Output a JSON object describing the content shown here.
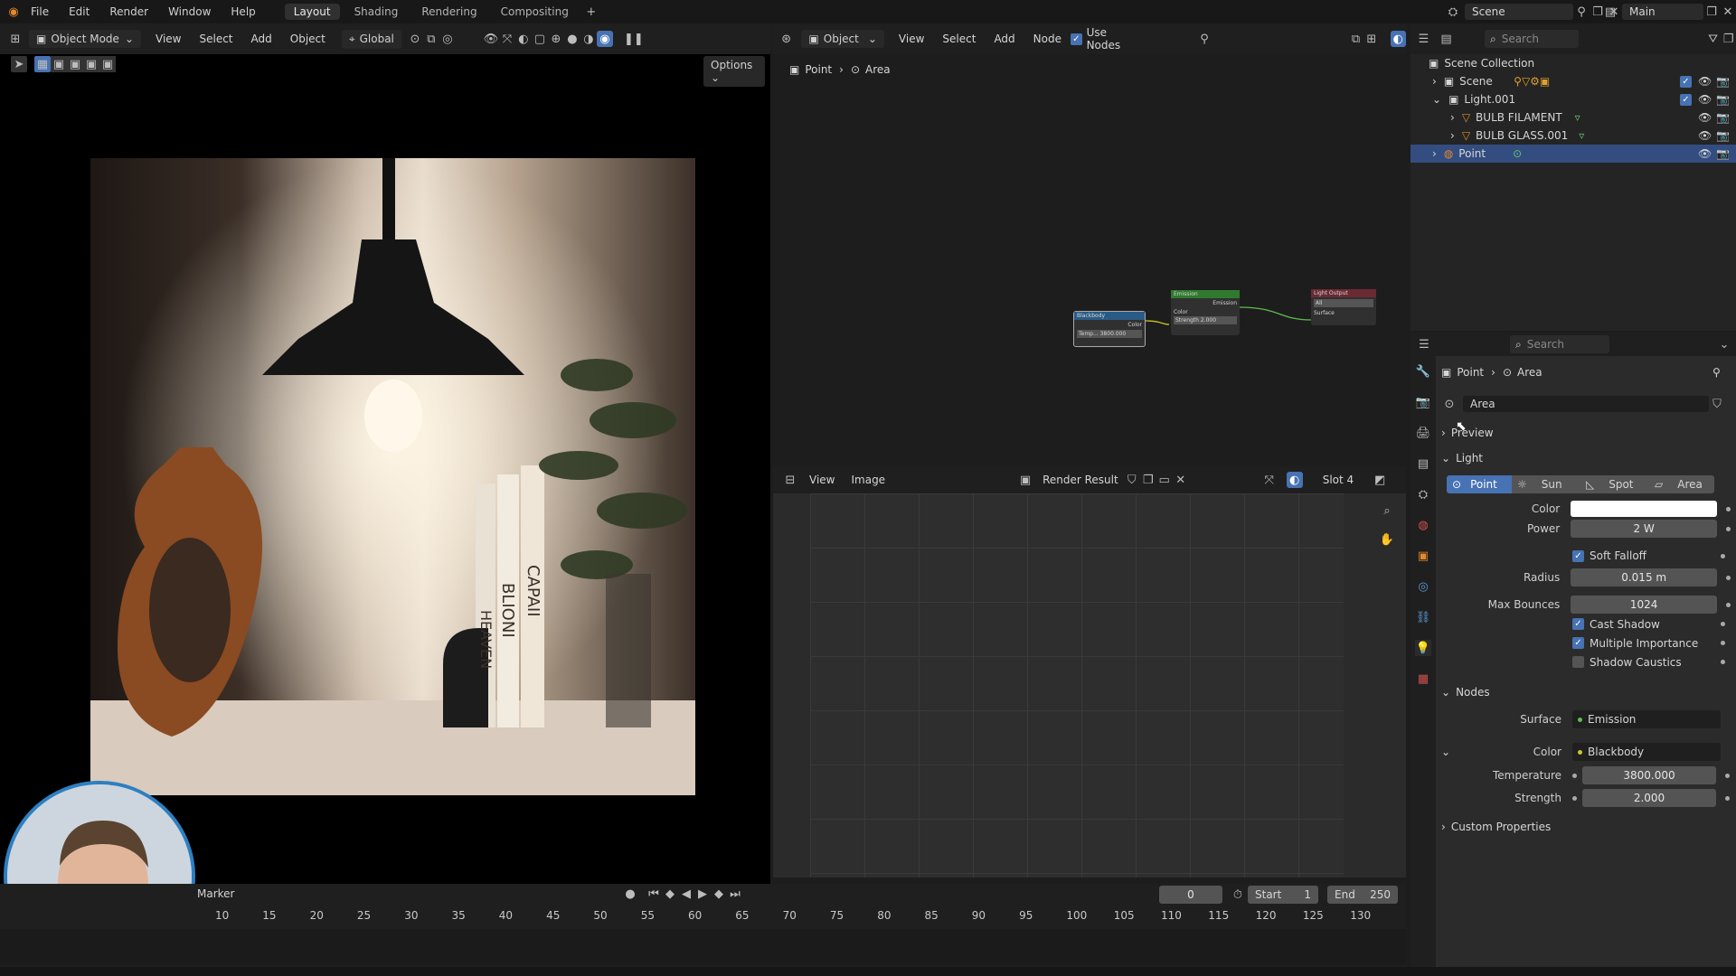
{
  "menus": [
    "File",
    "Edit",
    "Render",
    "Window",
    "Help"
  ],
  "workspace_tabs": [
    "Layout",
    "Shading",
    "Rendering",
    "Compositing"
  ],
  "active_workspace": "Layout",
  "scene_name": "Scene",
  "view_layer": "Main",
  "viewport_header": {
    "mode": "Object Mode",
    "menu": [
      "View",
      "Select",
      "Add",
      "Object"
    ],
    "orientation": "Global",
    "options": "Options"
  },
  "node_editor_header": {
    "type": "Object",
    "menu": [
      "View",
      "Select",
      "Add",
      "Node"
    ],
    "use_nodes": "Use Nodes",
    "breadcrumb": [
      "Point",
      "Area"
    ],
    "nodes": {
      "blackbody": {
        "title": "Blackbody",
        "out": "Color",
        "field": "Temp... 3800.000"
      },
      "emission": {
        "title": "Emission",
        "out": "Emission",
        "in_color": "Color",
        "in_strength": "Strength 2.000"
      },
      "output": {
        "title": "Light Output",
        "target": "All",
        "in": "Surface"
      }
    }
  },
  "image_editor_header": {
    "menu": [
      "View",
      "Image"
    ],
    "image": "Render Result",
    "slot": "Slot 4"
  },
  "outliner": {
    "search_placeholder": "Search",
    "collection": "Scene Collection",
    "items": [
      {
        "name": "Scene",
        "level": 1
      },
      {
        "name": "Light.001",
        "level": 1
      },
      {
        "name": "BULB FILAMENT",
        "level": 2
      },
      {
        "name": "BULB GLASS.001",
        "level": 2
      },
      {
        "name": "Point",
        "level": 1
      }
    ]
  },
  "properties": {
    "search_placeholder": "Search",
    "breadcrumb": [
      "Point",
      "Area"
    ],
    "datablock": "Area",
    "sections": {
      "preview": "Preview",
      "light": "Light",
      "nodes": "Nodes",
      "custom": "Custom Properties"
    },
    "light_types": [
      "Point",
      "Sun",
      "Spot",
      "Area"
    ],
    "active_light_type": "Point",
    "color_label": "Color",
    "power_label": "Power",
    "power_value": "2 W",
    "soft_falloff": "Soft Falloff",
    "radius_label": "Radius",
    "radius_value": "0.015 m",
    "max_bounces_label": "Max Bounces",
    "max_bounces_value": "1024",
    "cast_shadow": "Cast Shadow",
    "multiple_importance": "Multiple Importance",
    "shadow_caustics": "Shadow Caustics",
    "surface_label": "Surface",
    "surface_value": "Emission",
    "node_color_label": "Color",
    "node_color_value": "Blackbody",
    "temperature_label": "Temperature",
    "temperature_value": "3800.000",
    "strength_label": "Strength",
    "strength_value": "2.000"
  },
  "timeline": {
    "marker": "Marker",
    "current_frame": "0",
    "start_label": "Start",
    "start_value": "1",
    "end_label": "End",
    "end_value": "250",
    "ticks": [
      "10",
      "15",
      "20",
      "25",
      "30",
      "35",
      "40",
      "45",
      "50",
      "55",
      "60",
      "65",
      "70",
      "75",
      "80",
      "85",
      "90",
      "95",
      "100",
      "105",
      "110",
      "115",
      "120",
      "125",
      "130"
    ]
  },
  "render_book_titles": [
    "HEAVEN",
    "BLIONI",
    "CAPAII"
  ],
  "colors": {
    "accent": "#4772b3",
    "selected_row": "#334d80",
    "node_green": "#2f7a2f",
    "node_blue": "#2a5b86",
    "node_red": "#6b2a33"
  }
}
